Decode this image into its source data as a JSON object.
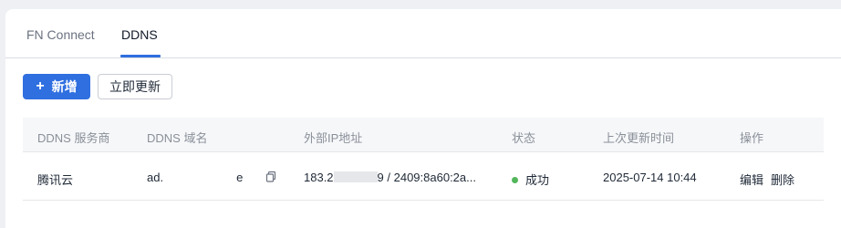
{
  "tabs": [
    {
      "label": "FN Connect"
    },
    {
      "label": "DDNS"
    }
  ],
  "toolbar": {
    "add_label": "新增",
    "update_label": "立即更新"
  },
  "table": {
    "headers": [
      "DDNS 服务商",
      "DDNS 域名",
      "外部IP地址",
      "状态",
      "上次更新时间",
      "操作"
    ],
    "rows": [
      {
        "provider": "腾讯云",
        "domain_start": "ad.",
        "domain_end": "e",
        "ip_start": "183.2",
        "ip_end": "9 / 2409:8a60:2a...",
        "status": "成功",
        "updated": "2025-07-14 10:44",
        "actions": [
          "编辑",
          "删除"
        ]
      }
    ]
  },
  "colors": {
    "accent": "#2f6fe0",
    "success": "#52b65b"
  }
}
